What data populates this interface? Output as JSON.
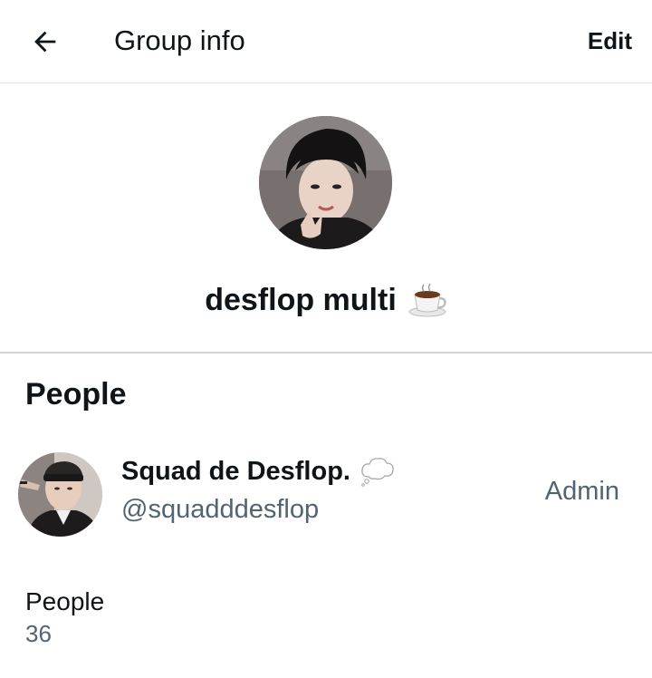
{
  "header": {
    "title": "Group info",
    "edit_label": "Edit",
    "back_icon": "arrow-left-icon"
  },
  "group": {
    "name": "desflop multi",
    "emoji_icon": "coffee-cup-icon"
  },
  "people_section": {
    "title": "People",
    "members": [
      {
        "name": "Squad de Desflop.",
        "emoji_icon": "thought-bubble-icon",
        "handle": "@squadddesflop",
        "role": "Admin"
      }
    ]
  },
  "people_count": {
    "label": "People",
    "value": "36"
  },
  "colors": {
    "primary_text": "#0f1419",
    "secondary_text": "#536471",
    "divider": "#dfe3e6"
  }
}
